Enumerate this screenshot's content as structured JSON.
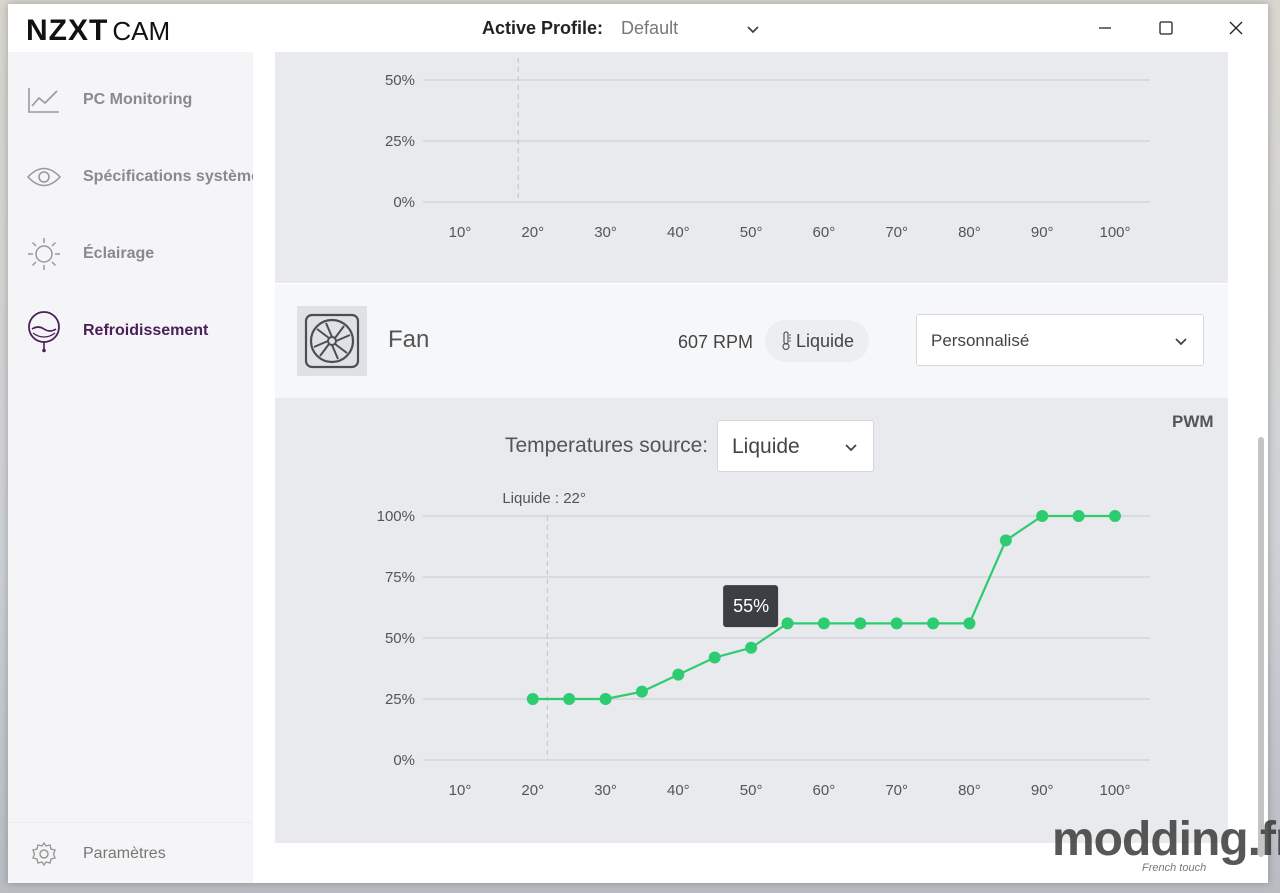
{
  "app": {
    "logo_bold": "NZXT",
    "logo_light": "CAM"
  },
  "header": {
    "profile_label": "Active Profile:",
    "profile_value": "Default"
  },
  "sidebar": {
    "items": [
      {
        "label": "PC Monitoring",
        "icon": "line-chart-icon",
        "active": false
      },
      {
        "label": "Spécifications système",
        "icon": "eye-icon",
        "active": false
      },
      {
        "label": "Éclairage",
        "icon": "sun-icon",
        "active": false
      },
      {
        "label": "Refroidissement",
        "icon": "cooling-drop-icon",
        "active": true
      }
    ],
    "settings_label": "Paramètres"
  },
  "fan": {
    "name": "Fan",
    "rpm": "607 RPM",
    "source_pill": "Liquide",
    "mode": "Personnalisé",
    "mode_label": "PWM",
    "temp_source_label": "Temperatures source:",
    "temp_source_value": "Liquide",
    "current_temp_label": "Liquide : 22°",
    "tooltip": "55%"
  },
  "watermark": {
    "text": "modding.fr",
    "sub": "French touch"
  },
  "colors": {
    "accent_green": "#2ecc71",
    "active_purple": "#4a1f5a",
    "panel_bg": "#e8eaed"
  },
  "chart_data": [
    {
      "type": "line",
      "x_ticks": [
        "10°",
        "20°",
        "30°",
        "40°",
        "50°",
        "60°",
        "70°",
        "80°",
        "90°",
        "100°"
      ],
      "y_ticks": [
        "50%",
        "25%",
        "0%"
      ],
      "xlim": [
        10,
        100
      ],
      "ylim": [
        0,
        50
      ],
      "current_temp": 18,
      "series": []
    },
    {
      "type": "line",
      "x_ticks": [
        "10°",
        "20°",
        "30°",
        "40°",
        "50°",
        "60°",
        "70°",
        "80°",
        "90°",
        "100°"
      ],
      "y_ticks": [
        "100%",
        "75%",
        "50%",
        "25%",
        "0%"
      ],
      "xlim": [
        10,
        100
      ],
      "ylim": [
        0,
        100
      ],
      "current_temp": 22,
      "series": [
        {
          "x": [
            20,
            25,
            30,
            35,
            40,
            45,
            50,
            55,
            60,
            65,
            70,
            75,
            80,
            85,
            90,
            95,
            100
          ],
          "y": [
            25,
            25,
            25,
            28,
            35,
            42,
            46,
            56,
            56,
            56,
            56,
            56,
            56,
            90,
            100,
            100,
            100
          ]
        }
      ]
    }
  ]
}
